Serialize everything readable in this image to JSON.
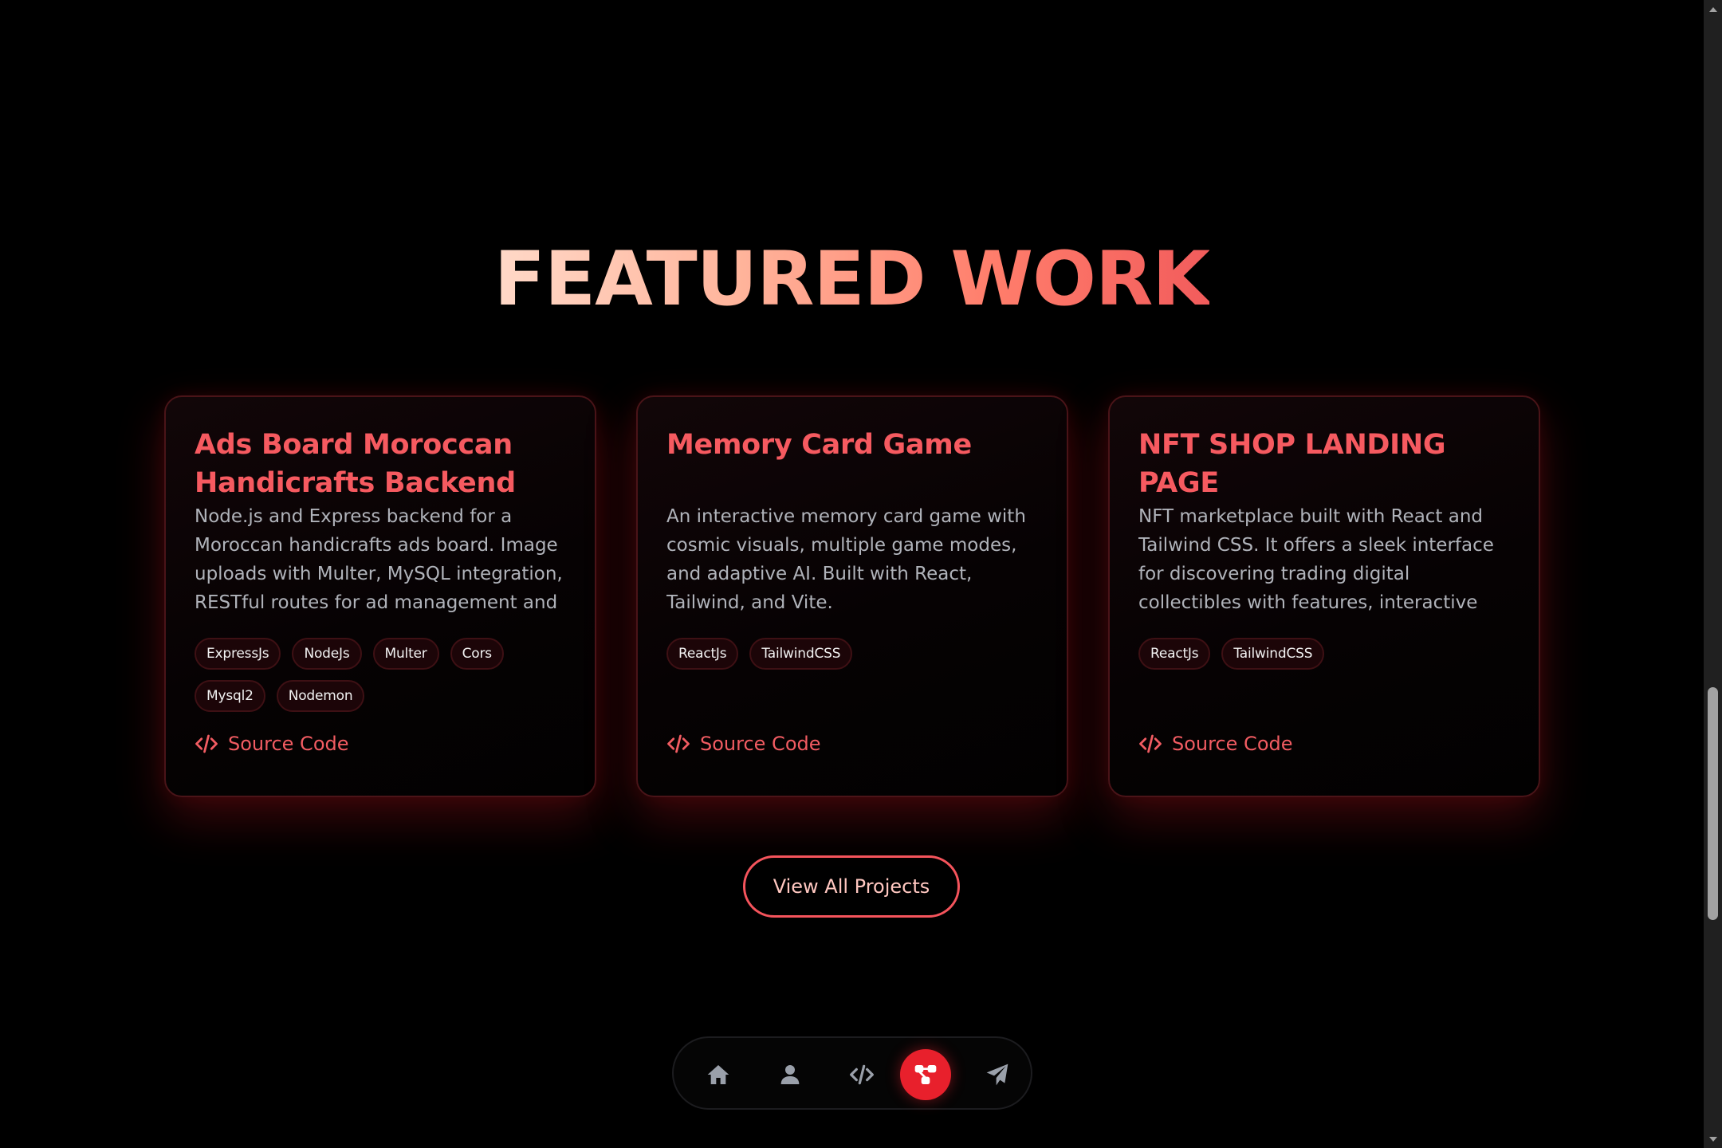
{
  "section": {
    "title": "FEATURED WORK"
  },
  "projects": [
    {
      "title": "Ads Board Moroccan Handicrafts Backend",
      "description": "Node.js and Express backend for a Moroccan handicrafts ads board. Image uploads with Multer, MySQL integration, RESTful routes for ad management and admin stats.",
      "tags": [
        "ExpressJs",
        "NodeJs",
        "Multer",
        "Cors",
        "Mysql2",
        "Nodemon"
      ],
      "source_label": "Source Code"
    },
    {
      "title": "Memory Card Game",
      "description": "An interactive memory card game with cosmic visuals, multiple game modes, and adaptive AI. Built with React, Tailwind, and Vite.",
      "tags": [
        "ReactJs",
        "TailwindCSS"
      ],
      "source_label": "Source Code"
    },
    {
      "title": "NFT SHOP LANDING PAGE",
      "description": "NFT marketplace built with React and Tailwind CSS. It offers a sleek interface for discovering trading digital collectibles with features, interactive NFT showcases, and responsive...",
      "tags": [
        "ReactJs",
        "TailwindCSS"
      ],
      "source_label": "Source Code"
    }
  ],
  "view_all_label": "View All Projects",
  "dock": {
    "items": [
      {
        "icon": "home-icon",
        "active": false
      },
      {
        "icon": "user-icon",
        "active": false
      },
      {
        "icon": "code-icon",
        "active": false
      },
      {
        "icon": "projects-icon",
        "active": true
      },
      {
        "icon": "send-icon",
        "active": false
      }
    ]
  },
  "colors": {
    "accent": "#f25c62",
    "background": "#000000",
    "active_dock": "#e8202c"
  }
}
